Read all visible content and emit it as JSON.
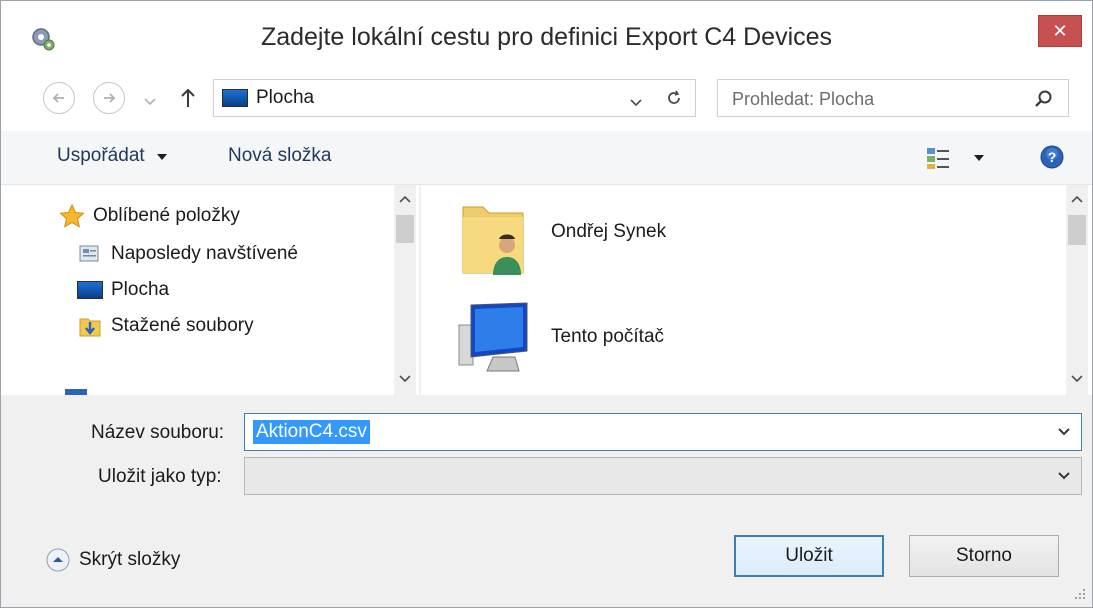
{
  "window": {
    "title": "Zadejte lokální cestu pro definici Export C4 Devices",
    "close_label": "✕",
    "close_color": "#c75050"
  },
  "nav": {
    "back_icon": "back-arrow-icon",
    "forward_icon": "forward-arrow-icon",
    "up_icon": "up-arrow-icon",
    "address": "Plocha",
    "search_placeholder": "Prohledat: Plocha"
  },
  "toolbar": {
    "organize_label": "Uspořádat",
    "new_folder_label": "Nová složka"
  },
  "sidebar": {
    "items": [
      {
        "label": "Oblíbené položky",
        "icon": "star-icon"
      },
      {
        "label": "Naposledy navštívené",
        "icon": "recent-places-icon"
      },
      {
        "label": "Plocha",
        "icon": "desktop-icon"
      },
      {
        "label": "Stažené soubory",
        "icon": "downloads-icon"
      }
    ]
  },
  "files": {
    "items": [
      {
        "label": "Ondřej Synek",
        "icon": "user-folder-icon"
      },
      {
        "label": "Tento počítač",
        "icon": "computer-icon"
      }
    ]
  },
  "form": {
    "filename_label": "Název souboru:",
    "filename_value": "AktionC4.csv",
    "filetype_label": "Uložit jako typ:",
    "filetype_value": "",
    "hide_folders_label": "Skrýt složky",
    "save_label": "Uložit",
    "cancel_label": "Storno"
  },
  "colors": {
    "accent": "#3c7fb1",
    "selection": "#3399ff",
    "link_text": "#1e395b"
  }
}
